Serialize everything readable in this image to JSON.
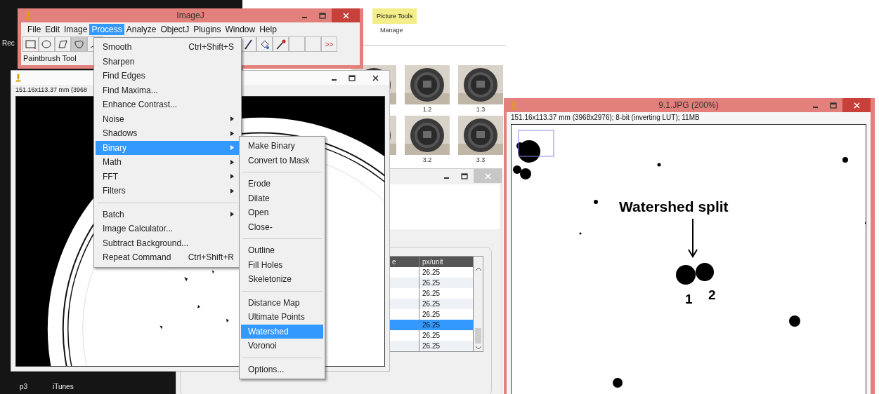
{
  "desktop": {
    "icons": [
      {
        "label": "Rec"
      },
      {
        "label": "p3"
      },
      {
        "label": "iTunes"
      }
    ]
  },
  "explorer": {
    "ribbon_tab": "Picture Tools",
    "ribbon_group": "Manage",
    "thumbnail_rows": [
      {
        "thumbnails": [
          {
            "kind": "picture"
          },
          {
            "kind": "picture",
            "caption": "1.2"
          },
          {
            "kind": "picture",
            "caption": "1.3"
          }
        ]
      },
      {
        "thumbnails": [
          {
            "kind": "picture"
          },
          {
            "kind": "picture",
            "caption": "3.2"
          },
          {
            "kind": "picture",
            "caption": "3.3"
          }
        ]
      }
    ]
  },
  "table_window": {
    "columns": [
      "e",
      "px/unit"
    ],
    "rows": [
      {
        "value": "26.25",
        "selected": false
      },
      {
        "value": "26.25",
        "selected": false
      },
      {
        "value": "26.25",
        "selected": false
      },
      {
        "value": "26.25",
        "selected": false
      },
      {
        "value": "26.25",
        "selected": false
      },
      {
        "value": "26.25",
        "selected": true
      },
      {
        "value": "26.25",
        "selected": false
      },
      {
        "value": "26.25",
        "selected": false
      }
    ]
  },
  "image_window": {
    "info": "151.16x113.37 mm (3968"
  },
  "imagej": {
    "title": "ImageJ",
    "menus": [
      {
        "label": "File",
        "selected": false
      },
      {
        "label": "Edit",
        "selected": false
      },
      {
        "label": "Image",
        "selected": false
      },
      {
        "label": "Process",
        "selected": true
      },
      {
        "label": "Analyze",
        "selected": false
      },
      {
        "label": "ObjectJ",
        "selected": false
      },
      {
        "label": "Plugins",
        "selected": false
      },
      {
        "label": "Window",
        "selected": false
      },
      {
        "label": "Help",
        "selected": false
      }
    ],
    "tools_left": [
      {
        "kind": "rectangle",
        "selected": false
      },
      {
        "kind": "oval",
        "selected": false
      },
      {
        "kind": "polygon",
        "selected": false
      },
      {
        "kind": "freehand",
        "selected": true
      },
      {
        "kind": "line",
        "selected": false
      }
    ],
    "tools_right": [
      {
        "kind": "brush",
        "selected": false
      },
      {
        "kind": "bucket",
        "selected": false
      },
      {
        "kind": "dropper",
        "selected": false
      },
      {
        "kind": "empty",
        "selected": false
      },
      {
        "kind": "empty",
        "selected": false
      }
    ],
    "more_tools": ">>",
    "status": "Paintbrush Tool"
  },
  "process_menu": [
    {
      "kind": "item",
      "label": "Smooth",
      "shortcut": "Ctrl+Shift+S",
      "selected": false
    },
    {
      "kind": "item",
      "label": "Sharpen",
      "selected": false
    },
    {
      "kind": "item",
      "label": "Find Edges",
      "selected": false
    },
    {
      "kind": "item",
      "label": "Find Maxima...",
      "selected": false
    },
    {
      "kind": "item",
      "label": "Enhance Contrast...",
      "selected": false
    },
    {
      "kind": "submenu",
      "label": "Noise",
      "selected": false
    },
    {
      "kind": "submenu",
      "label": "Shadows",
      "selected": false
    },
    {
      "kind": "submenu",
      "label": "Binary",
      "selected": true
    },
    {
      "kind": "submenu",
      "label": "Math",
      "selected": false
    },
    {
      "kind": "submenu",
      "label": "FFT",
      "selected": false
    },
    {
      "kind": "submenu",
      "label": "Filters",
      "selected": false
    },
    {
      "kind": "separator"
    },
    {
      "kind": "submenu",
      "label": "Batch",
      "selected": false
    },
    {
      "kind": "item",
      "label": "Image Calculator...",
      "selected": false
    },
    {
      "kind": "item",
      "label": "Subtract Background...",
      "selected": false
    },
    {
      "kind": "item",
      "label": "Repeat Command",
      "shortcut": "Ctrl+Shift+R",
      "selected": false
    }
  ],
  "binary_menu": [
    {
      "kind": "item",
      "label": "Make Binary",
      "selected": false
    },
    {
      "kind": "item",
      "label": "Convert to Mask",
      "selected": false
    },
    {
      "kind": "separator"
    },
    {
      "kind": "item",
      "label": "Erode",
      "selected": false
    },
    {
      "kind": "item",
      "label": "Dilate",
      "selected": false
    },
    {
      "kind": "item",
      "label": "Open",
      "selected": false
    },
    {
      "kind": "item",
      "label": "Close-",
      "selected": false
    },
    {
      "kind": "separator"
    },
    {
      "kind": "item",
      "label": "Outline",
      "selected": false
    },
    {
      "kind": "item",
      "label": "Fill Holes",
      "selected": false
    },
    {
      "kind": "item",
      "label": "Skeletonize",
      "selected": false
    },
    {
      "kind": "separator"
    },
    {
      "kind": "item",
      "label": "Distance Map",
      "selected": false
    },
    {
      "kind": "item",
      "label": "Ultimate Points",
      "selected": false
    },
    {
      "kind": "item",
      "label": "Watershed",
      "selected": true
    },
    {
      "kind": "item",
      "label": "Voronoi",
      "selected": false
    },
    {
      "kind": "separator"
    },
    {
      "kind": "item",
      "label": "Options...",
      "selected": false
    }
  ],
  "result_window": {
    "title": "9.1.JPG (200%)",
    "info": "151.16x113.37 mm (3968x2976); 8-bit (inverting LUT); 11MB",
    "annotation": "Watershed split",
    "labels": [
      "1",
      "2"
    ]
  }
}
